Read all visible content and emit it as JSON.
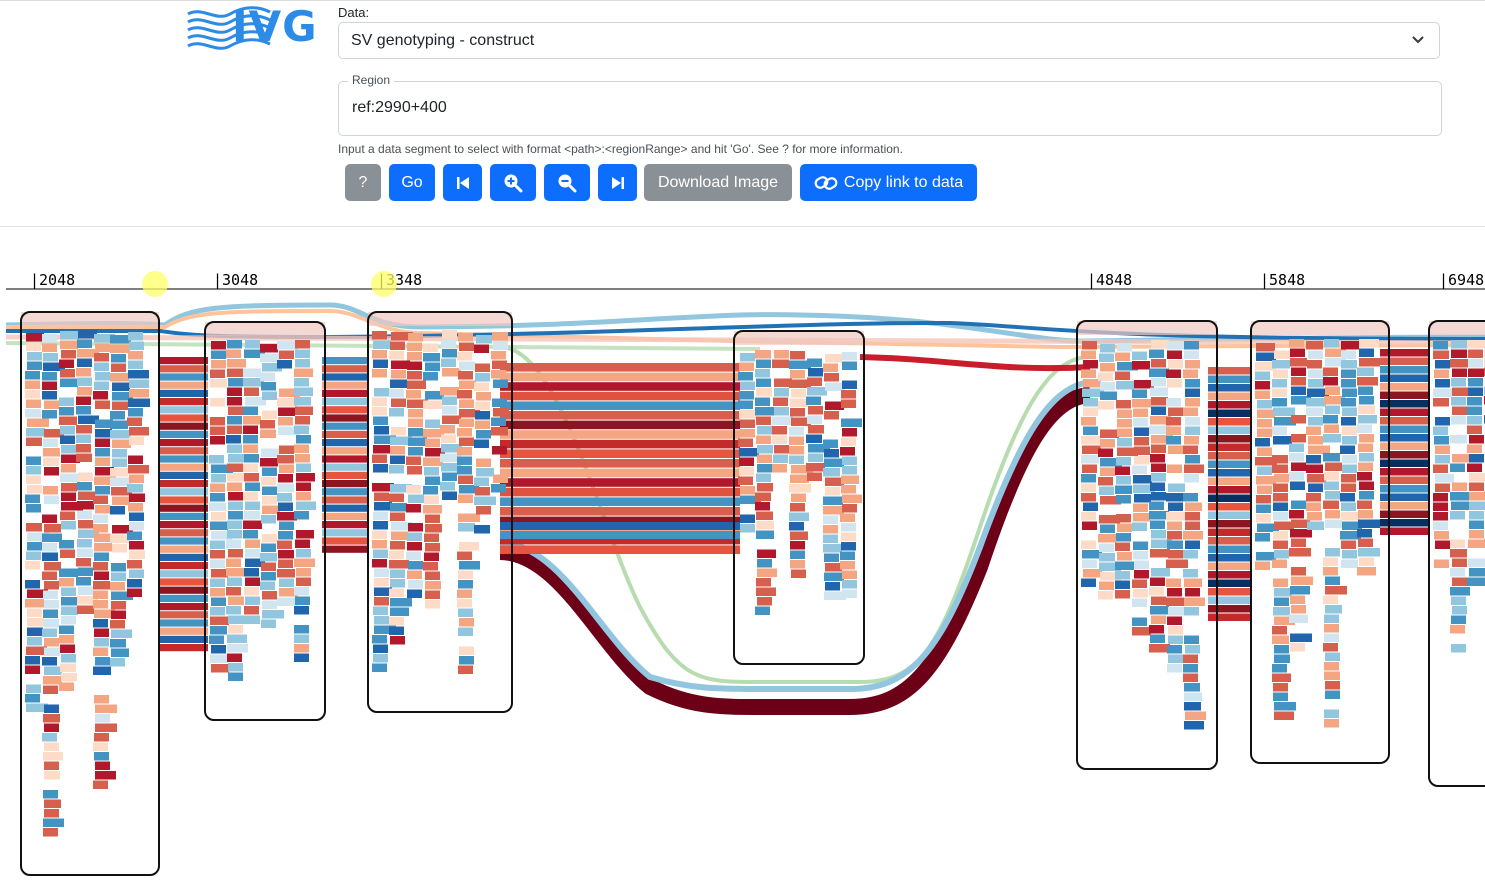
{
  "app": {
    "logo_text": "IVG"
  },
  "data_select": {
    "label": "Data:",
    "value": "SV genotyping - construct"
  },
  "region": {
    "legend": "Region",
    "value": "ref:2990+400"
  },
  "help_text": "Input a data segment to select with format <path>:<regionRange> and hit 'Go'. See ? for more information.",
  "toolbar": {
    "help_label": "?",
    "go_label": "Go",
    "download_label": "Download Image",
    "copy_link_label": "Copy link to data"
  },
  "ruler": {
    "ticks": [
      "|2048",
      "|3048",
      "|3348",
      "|4848",
      "|5848",
      "|6948"
    ]
  },
  "colors": {
    "primary": "#0d6efd",
    "secondary": "#8a9196",
    "logo": "#2b8be6",
    "palette": [
      "#67001f",
      "#b2182b",
      "#d6604d",
      "#f4a582",
      "#fddbc7",
      "#d1e5f0",
      "#92c5de",
      "#4393c3",
      "#2166ac",
      "#053061",
      "#e8e8e8"
    ]
  }
}
